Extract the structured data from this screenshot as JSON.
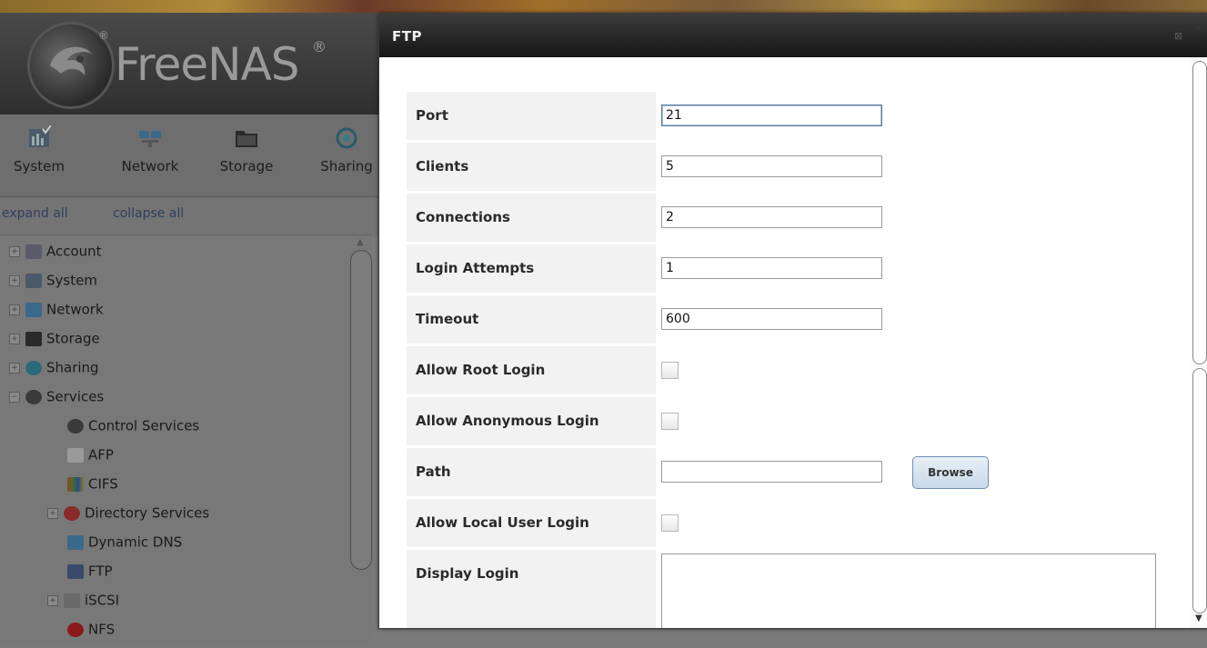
{
  "app": {
    "logo_text": "FreeNAS",
    "logo_reg": "®"
  },
  "topnav": {
    "items": [
      {
        "label": "System",
        "icon": "system-icon"
      },
      {
        "label": "Network",
        "icon": "network-icon"
      },
      {
        "label": "Storage",
        "icon": "storage-icon"
      },
      {
        "label": "Sharing",
        "icon": "sharing-icon"
      }
    ]
  },
  "tree_controls": {
    "expand_all": "expand all",
    "collapse_all": "collapse all"
  },
  "tree": {
    "items": [
      {
        "label": "Account",
        "icon": "account-icon",
        "expander": "+"
      },
      {
        "label": "System",
        "icon": "system-icon",
        "expander": "+"
      },
      {
        "label": "Network",
        "icon": "network-icon",
        "expander": "+"
      },
      {
        "label": "Storage",
        "icon": "storage-icon",
        "expander": "+"
      },
      {
        "label": "Sharing",
        "icon": "sharing-icon",
        "expander": "+"
      },
      {
        "label": "Services",
        "icon": "services-gear-icon",
        "expander": "−"
      },
      {
        "label": "Control Services",
        "icon": "gear-icon"
      },
      {
        "label": "AFP",
        "icon": "afp-icon"
      },
      {
        "label": "CIFS",
        "icon": "cifs-icon"
      },
      {
        "label": "Directory Services",
        "icon": "directory-services-icon",
        "expander": "+"
      },
      {
        "label": "Dynamic DNS",
        "icon": "network-icon"
      },
      {
        "label": "FTP",
        "icon": "ftp-icon"
      },
      {
        "label": "iSCSI",
        "icon": "iscsi-icon",
        "expander": "+"
      },
      {
        "label": "NFS",
        "icon": "nfs-icon"
      }
    ]
  },
  "dialog": {
    "title": "FTP",
    "close_glyph": "⊠",
    "fields": {
      "port": {
        "label": "Port",
        "value": "21"
      },
      "clients": {
        "label": "Clients",
        "value": "5"
      },
      "connections": {
        "label": "Connections",
        "value": "2"
      },
      "login_attempts": {
        "label": "Login Attempts",
        "value": "1"
      },
      "timeout": {
        "label": "Timeout",
        "value": "600"
      },
      "allow_root_login": {
        "label": "Allow Root Login",
        "checked": false
      },
      "allow_anonymous_login": {
        "label": "Allow Anonymous Login",
        "checked": false
      },
      "path": {
        "label": "Path",
        "value": "",
        "browse_label": "Browse"
      },
      "allow_local_user_login": {
        "label": "Allow Local User Login",
        "checked": false
      },
      "display_login": {
        "label": "Display Login",
        "value": ""
      }
    }
  },
  "colors": {
    "titlebar": "#1f1f1f",
    "label_bg": "#f2f2f2",
    "browse_border": "#6f8eae",
    "overlay_gray": "#787878"
  }
}
